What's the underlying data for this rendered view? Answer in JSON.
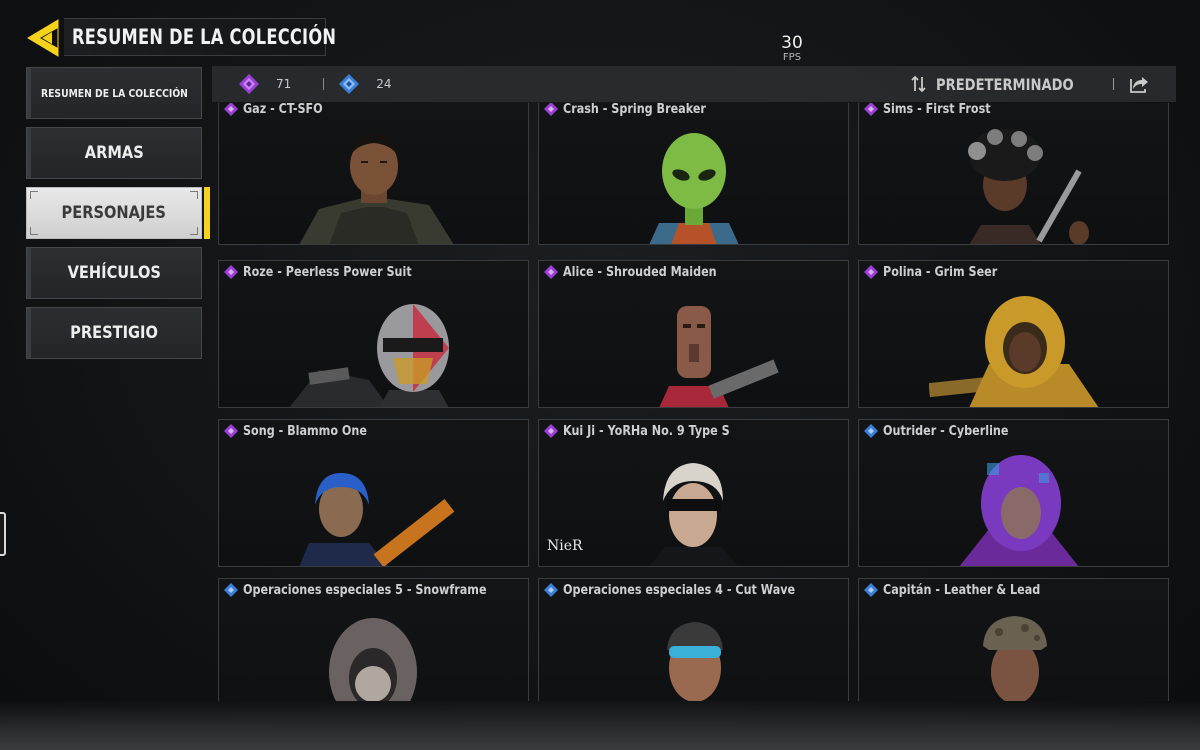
{
  "header": {
    "title": "RESUMEN DE LA COLECCIÓN",
    "accent_color": "#f5d21c"
  },
  "fps": {
    "value": "30",
    "label": "FPS"
  },
  "sidebar": {
    "items": [
      {
        "label": "RESUMEN DE LA COLECCIÓN",
        "active": false
      },
      {
        "label": "ARMAS",
        "active": false
      },
      {
        "label": "PERSONAJES",
        "active": true
      },
      {
        "label": "VEHÍCULOS",
        "active": false
      },
      {
        "label": "PRESTIGIO",
        "active": false
      }
    ]
  },
  "topbar": {
    "legendary_count": "71",
    "epic_count": "24",
    "sort_label": "PREDETERMINADO"
  },
  "colors": {
    "legendary": "#9b3fd6",
    "epic": "#3a7fd8"
  },
  "cards": [
    {
      "title": "Gaz - CT-SFO",
      "rarity": "legendary",
      "portrait": "soldier"
    },
    {
      "title": "Crash - Spring Breaker",
      "rarity": "legendary",
      "portrait": "alien"
    },
    {
      "title": "Sims - First Frost",
      "rarity": "legendary",
      "portrait": "afro"
    },
    {
      "title": "Roze - Peerless Power Suit",
      "rarity": "legendary",
      "portrait": "helmet"
    },
    {
      "title": "Alice - Shrouded Maiden",
      "rarity": "legendary",
      "portrait": "mask"
    },
    {
      "title": "Polina - Grim Seer",
      "rarity": "legendary",
      "portrait": "hood-gold"
    },
    {
      "title": "Song - Blammo One",
      "rarity": "legendary",
      "portrait": "blue-hair"
    },
    {
      "title": "Kui Ji - YoRHa No. 9 Type S",
      "rarity": "legendary",
      "portrait": "blindfold",
      "badge": "NieR"
    },
    {
      "title": "Outrider - Cyberline",
      "rarity": "epic",
      "portrait": "hood-purple"
    },
    {
      "title": "Operaciones especiales 5 - Snowframe",
      "rarity": "epic",
      "portrait": "hood-grey"
    },
    {
      "title": "Operaciones especiales 4 - Cut Wave",
      "rarity": "epic",
      "portrait": "goggles"
    },
    {
      "title": "Capitán - Leather & Lead",
      "rarity": "epic",
      "portrait": "camo"
    }
  ]
}
